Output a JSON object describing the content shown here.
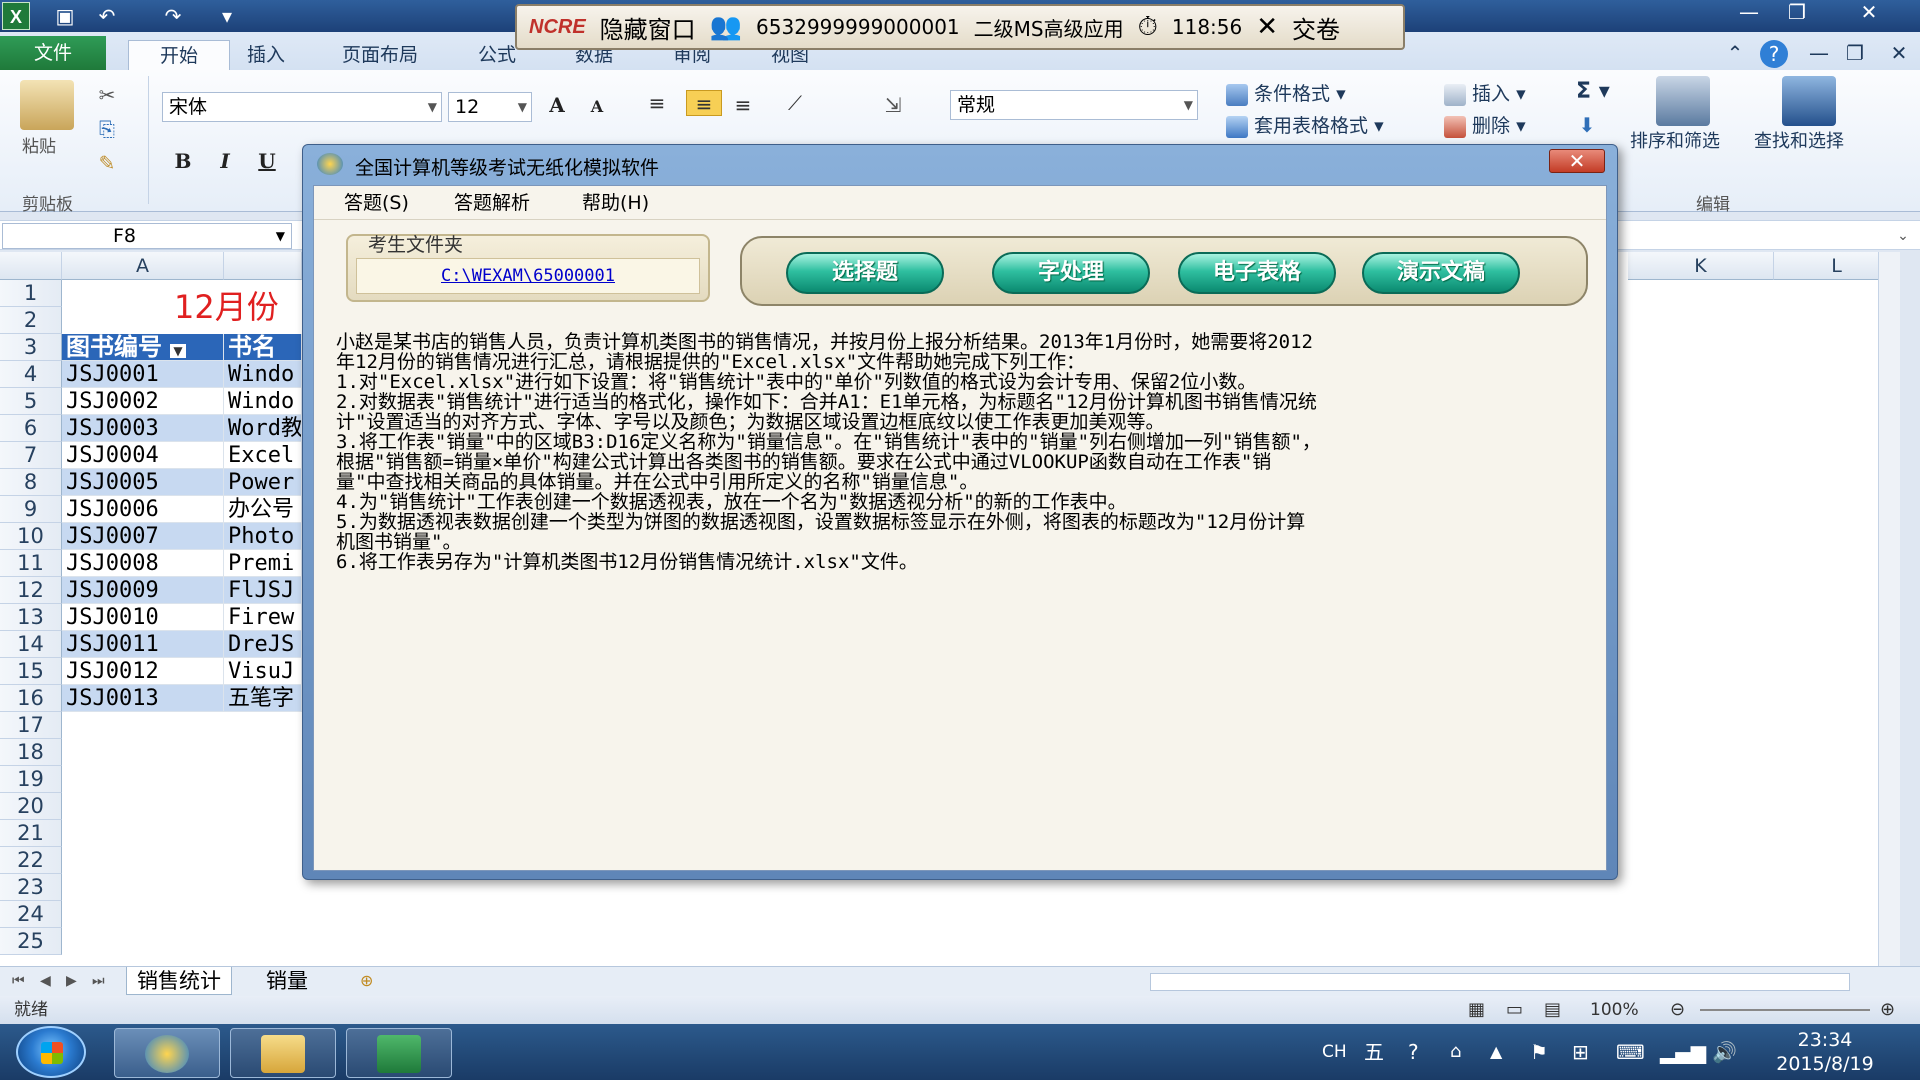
{
  "titlebar": {
    "window_buttons": [
      "—",
      "❐",
      "✕"
    ]
  },
  "exam_toolbar": {
    "logo": "NCRE",
    "hide_window": "隐藏窗口",
    "candidate_id": "6532999999000001",
    "exam_name": "二级MS高级应用",
    "time_left": "118:56",
    "submit": "交卷"
  },
  "ribbon_tabs": [
    "文件",
    "开始",
    "插入",
    "页面布局",
    "公式",
    "数据",
    "审阅",
    "视图"
  ],
  "ribbon": {
    "paste_label": "粘贴",
    "clipboard_label": "剪贴板",
    "font_name": "宋体",
    "font_size": "12",
    "grow_font": "A",
    "shrink_font": "A",
    "bold": "B",
    "italic": "I",
    "underline": "U",
    "number_format": "常规",
    "cond_format": "条件格式",
    "table_format": "套用表格格式",
    "insert": "插入",
    "delete": "删除",
    "sigma": "Σ",
    "sort_filter": "排序和筛选",
    "find_select": "查找和选择",
    "edit_label": "编辑"
  },
  "namebox": "F8",
  "columns": [
    "A",
    "K",
    "L"
  ],
  "rows": [
    "1",
    "2",
    "3",
    "4",
    "5",
    "6",
    "7",
    "8",
    "9",
    "10",
    "11",
    "12",
    "13",
    "14",
    "15",
    "16",
    "17",
    "18",
    "19",
    "20",
    "21",
    "22",
    "23",
    "24",
    "25"
  ],
  "sheet": {
    "title_partial": "12月份",
    "header_a": "图书编号",
    "header_b": "书名",
    "data": [
      {
        "id": "JSJ0001",
        "name": "Windo"
      },
      {
        "id": "JSJ0002",
        "name": "Windo"
      },
      {
        "id": "JSJ0003",
        "name": "Word教"
      },
      {
        "id": "JSJ0004",
        "name": "Excel"
      },
      {
        "id": "JSJ0005",
        "name": "Power"
      },
      {
        "id": "JSJ0006",
        "name": "办公号"
      },
      {
        "id": "JSJ0007",
        "name": "Photo"
      },
      {
        "id": "JSJ0008",
        "name": "Premi"
      },
      {
        "id": "JSJ0009",
        "name": "FlJSJ"
      },
      {
        "id": "JSJ0010",
        "name": "Firew"
      },
      {
        "id": "JSJ0011",
        "name": "DreJS"
      },
      {
        "id": "JSJ0012",
        "name": "VisuJ"
      },
      {
        "id": "JSJ0013",
        "name": "五笔字"
      }
    ]
  },
  "sheet_tabs": [
    "销售统计",
    "销量"
  ],
  "status": {
    "ready": "就绪",
    "zoom": "100%"
  },
  "tray": {
    "lang": "CH",
    "time": "23:34",
    "date": "2015/8/19"
  },
  "dialog": {
    "title": "全国计算机等级考试无纸化模拟软件",
    "menu": [
      "答题(S)",
      "答题解析",
      "帮助(H)"
    ],
    "folder_label": "考生文件夹",
    "folder_path": "C:\\WEXAM\\65000001",
    "buttons": [
      "选择题",
      "字处理",
      "电子表格",
      "演示文稿"
    ],
    "question_lines": [
      "小赵是某书店的销售人员，负责计算机类图书的销售情况，并按月份上报分析结果。2013年1月份时，她需要将2012",
      "年12月份的销售情况进行汇总，请根据提供的\"Excel.xlsx\"文件帮助她完成下列工作：",
      "1.对\"Excel.xlsx\"进行如下设置：将\"销售统计\"表中的\"单价\"列数值的格式设为会计专用、保留2位小数。",
      "2.对数据表\"销售统计\"进行适当的格式化，操作如下：合并A1：E1单元格，为标题名\"12月份计算机图书销售情况统",
      "计\"设置适当的对齐方式、字体、字号以及颜色；为数据区域设置边框底纹以使工作表更加美观等。",
      "3.将工作表\"销量\"中的区域B3:D16定义名称为\"销量信息\"。在\"销售统计\"表中的\"销量\"列右侧增加一列\"销售额\"，",
      "根据\"销售额=销量×单价\"构建公式计算出各类图书的销售额。要求在公式中通过VLOOKUP函数自动在工作表\"销",
      "量\"中查找相关商品的具体销量。并在公式中引用所定义的名称\"销量信息\"。",
      "4.为\"销售统计\"工作表创建一个数据透视表，放在一个名为\"数据透视分析\"的新的工作表中。",
      "5.为数据透视表数据创建一个类型为饼图的数据透视图，设置数据标签显示在外侧，将图表的标题改为\"12月份计算",
      "机图书销量\"。",
      "6.将工作表另存为\"计算机类图书12月份销售情况统计.xlsx\"文件。"
    ]
  },
  "colors": {
    "header_blue": "#2b66b8",
    "row_blue": "#c7d9f1",
    "title_red": "#e02020",
    "pill_teal": "#2fbfa0"
  }
}
